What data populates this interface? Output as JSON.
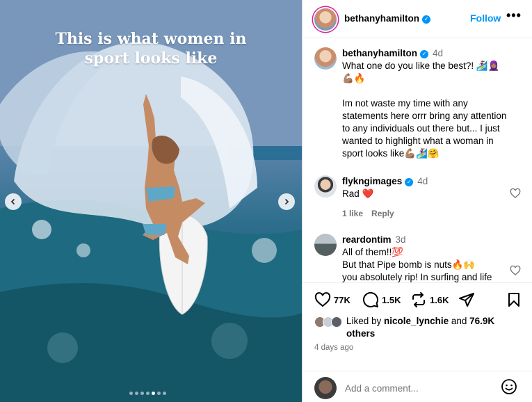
{
  "media": {
    "caption_line1": "This is what women in",
    "caption_line2": "sport looks like",
    "prev_icon": "chevron-left-icon",
    "next_icon": "chevron-right-icon",
    "carousel_total": 7,
    "carousel_active": 5
  },
  "header": {
    "username": "bethanyhamilton",
    "verified": true,
    "follow_label": "Follow",
    "more_label": "•••"
  },
  "post": {
    "username": "bethanyhamilton",
    "time": "4d",
    "text_line1": "What one do you like the best?! 🏄‍♀️🧕🏽",
    "text_line2": "💪🏽🔥",
    "text_line3": "Im not waste my time with any",
    "text_line4": "statements here orrr bring any attention",
    "text_line5": "to any individuals out there but...  I just",
    "text_line6": "wanted to highlight what a woman in",
    "text_line7": "sport looks like💪🏽🏄‍♀️🤗"
  },
  "comments": [
    {
      "username": "flykngimages",
      "verified": true,
      "time": "4d",
      "text": "Rad ❤️",
      "likes": "1 like",
      "reply": "Reply"
    },
    {
      "username": "reardontim",
      "verified": false,
      "time": "3d",
      "line1": "All of them!!💯",
      "line2": "But that Pipe bomb is nuts🔥🙌",
      "line3": "you absolutely rip! In surfing and life"
    }
  ],
  "actions": {
    "likes_count": "77K",
    "comments_count": "1.5K",
    "reposts_count": "1.6K"
  },
  "liked_by": {
    "prefix": "Liked by ",
    "user": "nicole_lynchie",
    "middle": " and ",
    "count": "76.9K",
    "suffix": "others"
  },
  "timestamp": "4 days ago",
  "add_comment": {
    "placeholder": "Add a comment..."
  },
  "colors": {
    "accent": "#0095f6",
    "muted": "#737373",
    "like_red": "#ed4956"
  }
}
